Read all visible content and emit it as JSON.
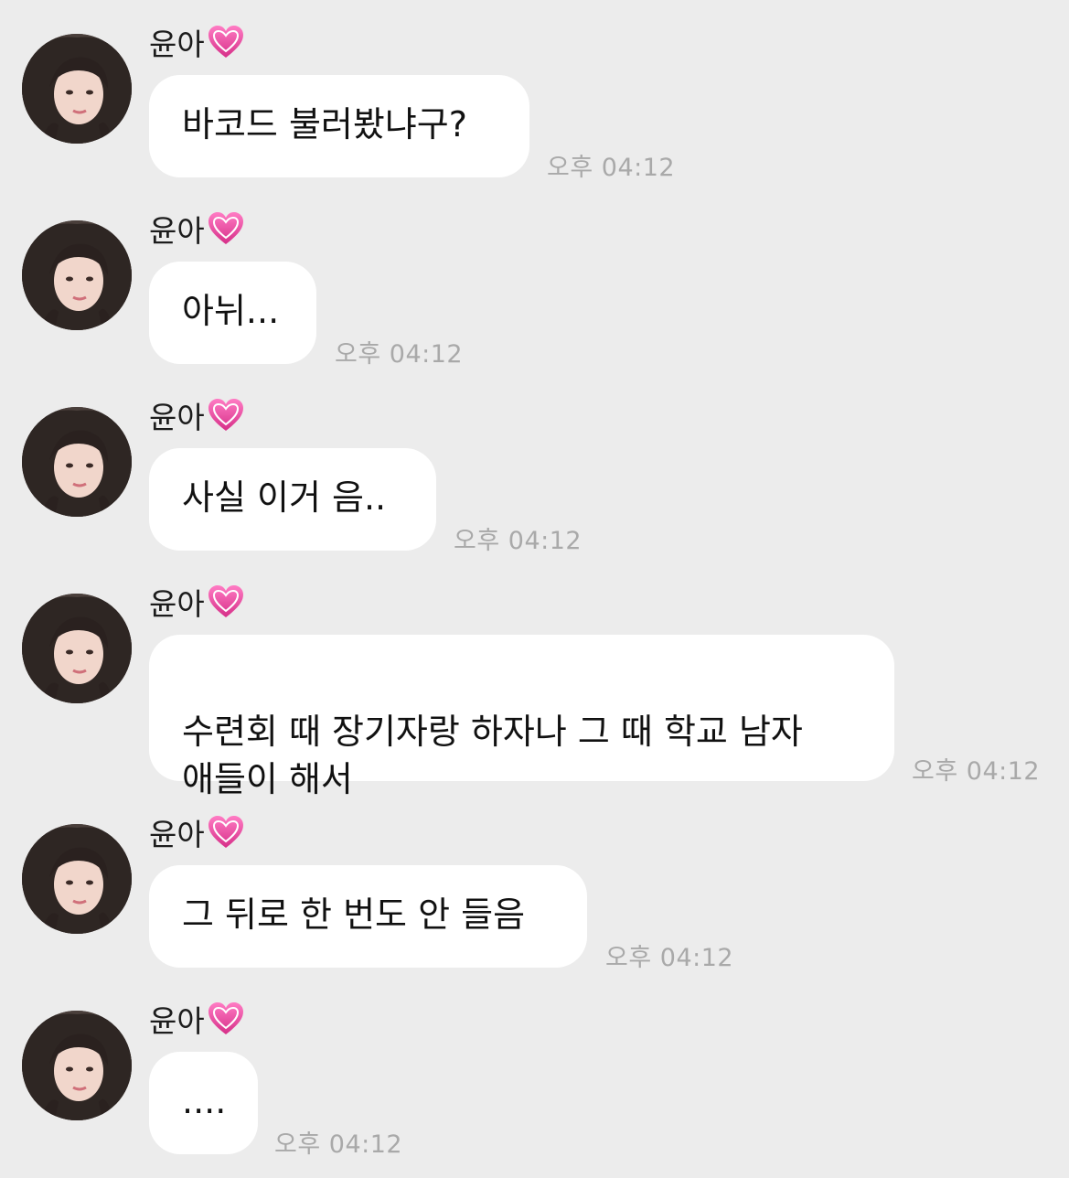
{
  "sender": {
    "name": "윤아",
    "badge_icon": "pink-heart-icon",
    "avatar_icon": "profile-photo"
  },
  "messages": [
    {
      "text": "바코드 불러봤냐구?",
      "time": "오후 04:12"
    },
    {
      "text": "아뉘...",
      "time": "오후 04:12"
    },
    {
      "text": "사실 이거 음..",
      "time": "오후 04:12"
    },
    {
      "text": "수련회 때 장기자랑 하자나 그 때 학교 남자\n애들이 해서",
      "time": "오후 04:12"
    },
    {
      "text": "그 뒤로 한 번도 안 들음",
      "time": "오후 04:12"
    },
    {
      "text": "....",
      "time": "오후 04:12"
    }
  ],
  "colors": {
    "background": "#ececec",
    "bubble": "#ffffff",
    "timestamp": "#a9a9a9",
    "heart": "#e8489a"
  }
}
